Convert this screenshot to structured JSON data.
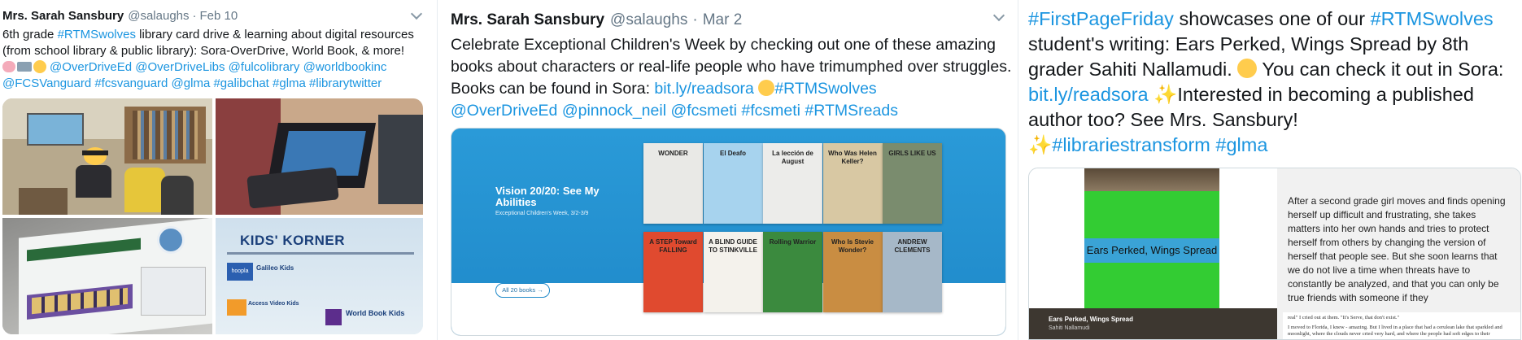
{
  "tweet1": {
    "name": "Mrs. Sarah Sansbury",
    "handle": "@salaughs",
    "sep": "·",
    "date": "Feb 10",
    "text_a": "6th grade ",
    "hashtag_wolves": "#RTMSwolves",
    "text_b": " library card drive & learning about digital resources (from school library & public library): Sora-OverDrive, World Book, & more!",
    "line3_links": "@OverDriveEd @OverDriveLibs @fulcolibrary @worldbookinc",
    "line4_links": "@FCSVanguard #fcsvanguard @glma #galibchat #glma #librarytwitter",
    "photo4": {
      "title": "KIDS' KORNER",
      "hoopla": "hoopla",
      "galileo": "Galileo Kids",
      "access": "Access Video Kids",
      "worldbook": "World Book Kids"
    }
  },
  "tweet2": {
    "name": "Mrs. Sarah Sansbury",
    "handle": "@salaughs",
    "sep": "·",
    "date": "Mar 2",
    "text_a": "Celebrate Exceptional Children's Week by checking out one of these amazing books about characters or real-life people who have trimumphed over struggles. Books can be found in Sora: ",
    "link": "bit.ly/readsora",
    "hashtag": "#RTMSwolves",
    "line4": "@OverDriveEd @pinnock_neil @fcsmeti #fcsmeti #RTMSreads",
    "card": {
      "title": "Vision 20/20: See My Abilities",
      "subtitle": "Exceptional Children's Week, 3/2-3/9",
      "button": "All 20 books →",
      "books": [
        {
          "label": "WONDER",
          "bg": "#e9e9e6"
        },
        {
          "label": "El Deafo",
          "bg": "#a7d3ee"
        },
        {
          "label": "La lección de August",
          "bg": "#ececea"
        },
        {
          "label": "Who Was Helen Keller?",
          "bg": "#d8c8a3"
        },
        {
          "label": "GIRLS LIKE US",
          "bg": "#7a8c6e"
        },
        {
          "label": "A STEP Toward FALLING",
          "bg": "#e04a2f"
        },
        {
          "label": "A BLIND GUIDE TO STINKVILLE",
          "bg": "#f4f2ec"
        },
        {
          "label": "Rolling Warrior",
          "bg": "#3b8a3e"
        },
        {
          "label": "Who Is Stevie Wonder?",
          "bg": "#c98d42"
        },
        {
          "label": "ANDREW CLEMENTS",
          "bg": "#a6b8c8"
        }
      ]
    }
  },
  "tweet3": {
    "hashtag1": "#FirstPageFriday",
    "text_a": " showcases one of our ",
    "hashtag2": "#RTMSwolves",
    "text_b": " student's writing: Ears Perked, Wings Spread by 8th grader Sahiti Nallamudi. ",
    "text_c": " You can check it out in Sora: ",
    "link": "bit.ly/readsora",
    "text_d": "Interested in becoming a published author too? See Mrs. Sansbury!",
    "hashtags_end": "#librariestransform #glma",
    "card": {
      "cover_title": "Ears Perked, Wings Spread",
      "bottom_title": "Ears Perked, Wings Spread",
      "bottom_author": "Sahiti Nallamudi",
      "page_text": "After a second grade girl moves and finds opening herself up difficult and frustrating, she takes matters into her own hands and tries to protect herself from others by changing the version of herself that people see. But she soon learns that we do not live a time when threats have to constantly be analyzed, and that you can only be true friends with someone if they",
      "snippet1": "real\" I cried out at them. \"It's Serve, that don't exist.\"",
      "snippet2": "I moved to Florida, I knew - amazing. But I lived in a place that had a cerulean lake that sparkled and moonlight, where the clouds never cried very hard, and where the people had soft edges to their"
    }
  }
}
